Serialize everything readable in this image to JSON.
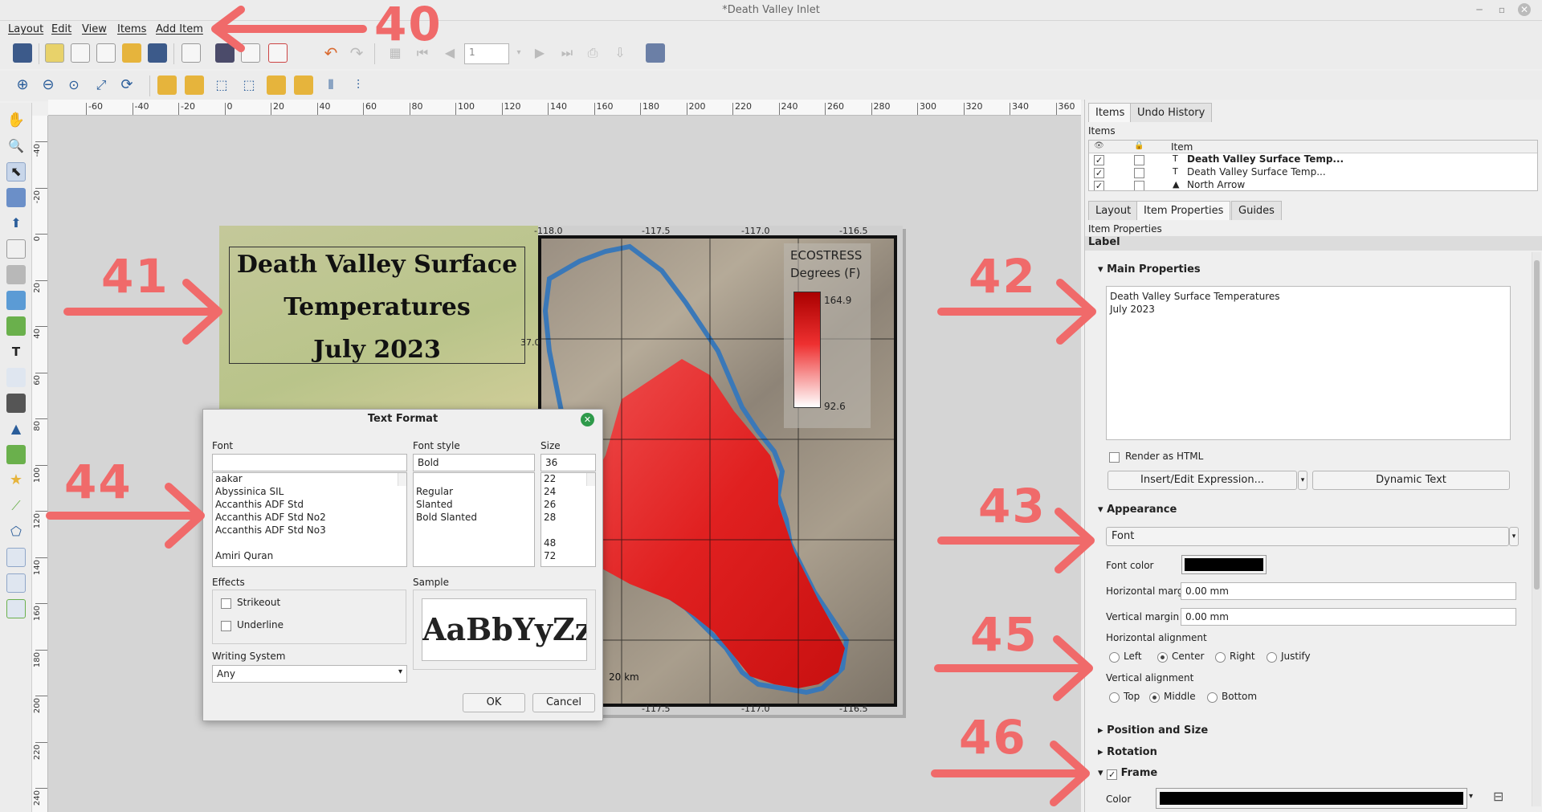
{
  "window": {
    "title": "*Death Valley Inlet"
  },
  "menu": [
    "Layout",
    "Edit",
    "View",
    "Items",
    "Add Item"
  ],
  "toolbar": {
    "page_value": "1"
  },
  "ruler_top": [
    "-60",
    "-40",
    "-20",
    "0",
    "20",
    "40",
    "60",
    "80",
    "100",
    "120",
    "140",
    "160",
    "180",
    "200",
    "220",
    "240",
    "260",
    "280",
    "300",
    "320",
    "340",
    "360"
  ],
  "ruler_left": [
    "-40",
    "-20",
    "0",
    "20",
    "40",
    "60",
    "80",
    "100",
    "120",
    "140",
    "160",
    "180",
    "200",
    "220",
    "240"
  ],
  "map": {
    "title_lines": [
      "Death Valley Surface",
      "Temperatures",
      "July 2023"
    ],
    "legend_title": "ECOSTRESS",
    "legend_unit": "Degrees (F)",
    "legend_max": "164.9",
    "legend_min": "92.6",
    "grid_top": [
      "-118.0",
      "-117.5",
      "-117.0",
      "-116.5"
    ],
    "grid_bottom": [
      "-117.5",
      "-117.0",
      "-116.5"
    ],
    "grid_left": "37.0",
    "scalebar": "20 km",
    "colors": {
      "hot": "#d01010",
      "outline": "#3a78b8"
    }
  },
  "annotations": [
    "40",
    "41",
    "42",
    "43",
    "44",
    "45",
    "46"
  ],
  "dialog": {
    "title": "Text Format",
    "font_label": "Font",
    "font_value": "",
    "fonts": [
      "aakar",
      "Abyssinica SIL",
      "Accanthis ADF Std",
      "Accanthis ADF Std No2",
      "Accanthis ADF Std No3",
      "",
      "Amiri Quran"
    ],
    "style_label": "Font style",
    "style_value": "Bold",
    "styles": [
      "",
      "Regular",
      "Slanted",
      "Bold Slanted"
    ],
    "size_label": "Size",
    "size_value": "36",
    "sizes": [
      "22",
      "24",
      "26",
      "28",
      "",
      "48",
      "72"
    ],
    "effects_label": "Effects",
    "strikeout": "Strikeout",
    "underline": "Underline",
    "writing_label": "Writing System",
    "writing_value": "Any",
    "sample_label": "Sample",
    "sample_text": "AaBbYyZz",
    "ok": "OK",
    "cancel": "Cancel"
  },
  "panel": {
    "tabs_top": [
      "Items",
      "Undo History"
    ],
    "items_header": "Items",
    "col_item": "Item",
    "items": [
      "Death Valley Surface Temp...",
      "Death Valley Surface Temp...",
      "North Arrow"
    ],
    "tabs_mid": [
      "Layout",
      "Item Properties",
      "Guides"
    ],
    "props_header": "Item Properties",
    "item_type": "Label",
    "main_props": "Main Properties",
    "label_text_line1": "Death Valley Surface Temperatures",
    "label_text_line2": "July 2023",
    "render_html": "Render as HTML",
    "insert_expr": "Insert/Edit Expression...",
    "dynamic_text": "Dynamic Text",
    "appearance": "Appearance",
    "font_btn": "Font",
    "font_color": "Font color",
    "hmargin_label": "Horizontal margin",
    "hmargin": "0.00 mm",
    "vmargin_label": "Vertical margin",
    "vmargin": "0.00 mm",
    "halign_label": "Horizontal alignment",
    "halign": [
      "Left",
      "Center",
      "Right",
      "Justify"
    ],
    "valign_label": "Vertical alignment",
    "valign": [
      "Top",
      "Middle",
      "Bottom"
    ],
    "pos_size": "Position and Size",
    "rotation": "Rotation",
    "frame": "Frame",
    "color_label": "Color"
  }
}
